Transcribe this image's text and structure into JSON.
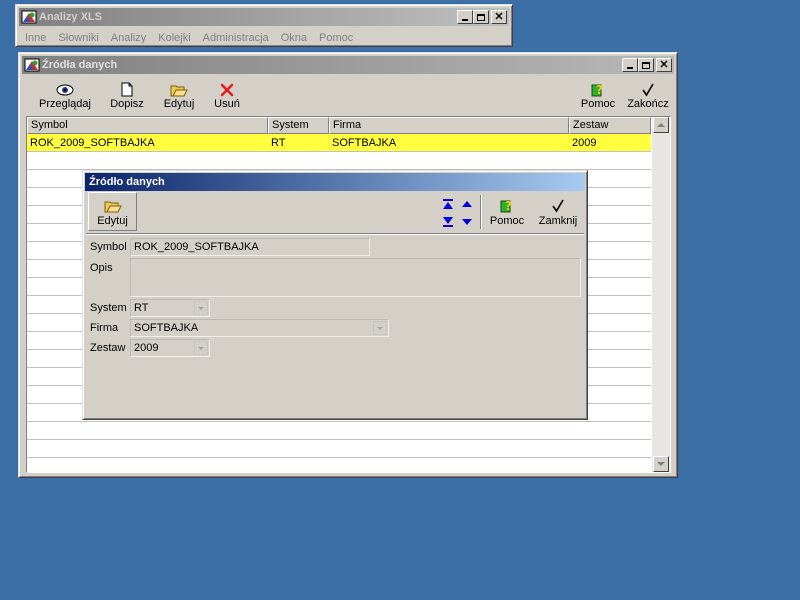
{
  "main_window": {
    "title": "Analizy XLS",
    "menu": [
      "Inne",
      "Słowniki",
      "Analizy",
      "Kolejki",
      "Administracja",
      "Okna",
      "Pomoc"
    ]
  },
  "sources_window": {
    "title": "Źródła danych",
    "toolbar": {
      "preview": "Przeglądaj",
      "add": "Dopisz",
      "edit": "Edytuj",
      "delete": "Usuń",
      "help": "Pomoc",
      "finish": "Zakończ"
    },
    "columns": [
      "Symbol",
      "System",
      "Firma",
      "Zestaw"
    ],
    "rows": [
      {
        "symbol": "ROK_2009_SOFTBAJKA",
        "system": "RT",
        "firma": "SOFTBAJKA",
        "zestaw": "2009"
      }
    ]
  },
  "source_dialog": {
    "title": "Źródło danych",
    "toolbar": {
      "edit": "Edytuj",
      "help": "Pomoc",
      "close": "Zamknij"
    },
    "labels": {
      "symbol": "Symbol",
      "description": "Opis",
      "system": "System",
      "company": "Firma",
      "set": "Zestaw"
    },
    "values": {
      "symbol": "ROK_2009_SOFTBAJKA",
      "description": "",
      "system": "RT",
      "company": "SOFTBAJKA",
      "set": "2009"
    }
  },
  "colors": {
    "desktop": "#3a6ea5",
    "selected_row": "#ffff3f",
    "active_title_start": "#0a246a",
    "active_title_end": "#a6caf0"
  }
}
